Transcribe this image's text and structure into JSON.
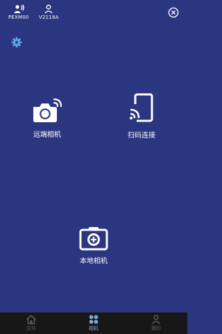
{
  "header": {
    "devices": [
      {
        "label": "PEXM00",
        "icon": "wireless-user-icon"
      },
      {
        "label": "V2118A",
        "icon": "user-icon"
      }
    ]
  },
  "main": {
    "tiles": [
      {
        "label": "远端相机",
        "icon": "remote-camera-icon"
      },
      {
        "label": "扫码连接",
        "icon": "cast-icon"
      },
      {
        "label": "本地相机",
        "icon": "local-camera-icon"
      }
    ]
  },
  "tabbar": {
    "tabs": [
      {
        "label": "文件",
        "icon": "home-icon",
        "active": false
      },
      {
        "label": "相机",
        "icon": "grid-icon",
        "active": true
      },
      {
        "label": "我的",
        "icon": "person-icon",
        "active": false
      }
    ]
  },
  "colors": {
    "background": "#2b3680",
    "accent": "#5aa9e6",
    "tabbar": "#171717",
    "tab_active": "#7ea6d8",
    "tab_inactive": "#5e5e5e"
  }
}
